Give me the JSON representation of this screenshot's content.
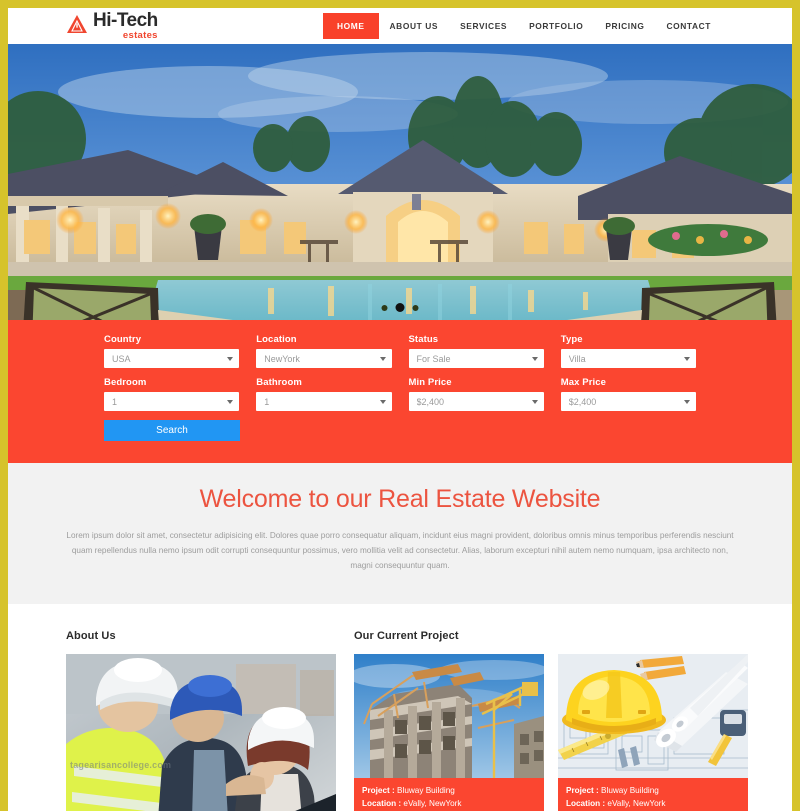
{
  "theme": {
    "border": "#d6c32b",
    "accent_red": "#fb4630",
    "accent_blue": "#2196f3",
    "heading_red": "#ec5440",
    "welcome_bg": "#f2f2f2"
  },
  "header": {
    "logo": {
      "icon": "triangle-logo-icon",
      "title": "Hi-Tech",
      "subtitle": "estates"
    },
    "nav": [
      {
        "label": "HOME",
        "active": true
      },
      {
        "label": "ABOUT US",
        "active": false
      },
      {
        "label": "SERVICES",
        "active": false
      },
      {
        "label": "PORTFOLIO",
        "active": false
      },
      {
        "label": "PRICING",
        "active": false
      },
      {
        "label": "CONTACT",
        "active": false
      }
    ]
  },
  "hero": {
    "alt": "Luxury mansion at dusk with swimming pool and lounge chairs",
    "dots": [
      {
        "active": false
      },
      {
        "active": true
      },
      {
        "active": false
      }
    ]
  },
  "search": {
    "row1": [
      {
        "label": "Country",
        "value": "USA",
        "name": "country-select"
      },
      {
        "label": "Location",
        "value": "NewYork",
        "name": "location-select"
      },
      {
        "label": "Status",
        "value": "For Sale",
        "name": "status-select"
      },
      {
        "label": "Type",
        "value": "Villa",
        "name": "type-select"
      }
    ],
    "row2": [
      {
        "label": "Bedroom",
        "value": "1",
        "name": "bedroom-select"
      },
      {
        "label": "Bathroom",
        "value": "1",
        "name": "bathroom-select"
      },
      {
        "label": "Min Price",
        "value": "$2,400",
        "name": "min-price-select"
      },
      {
        "label": "Max Price",
        "value": "$2,400",
        "name": "max-price-select"
      }
    ],
    "button_label": "Search"
  },
  "welcome": {
    "title": "Welcome to our Real Estate Website",
    "body": "Lorem ipsum dolor sit amet, consectetur adipisicing elit. Dolores quae porro consequatur aliquam, incidunt eius magni provident, doloribus omnis minus temporibus perferendis nesciunt quam repellendus nulla nemo ipsum odit corrupti consequuntur possimus, vero mollitia velit ad consectetur. Alias, laborum excepturi nihil autem nemo numquam, ipsa architecto non, magni consequuntur quam."
  },
  "about": {
    "title": "About Us",
    "image_alt": "Three construction workers in hard hats reviewing plans",
    "watermark": "tagearisancollege.com"
  },
  "projects": {
    "title": "Our Current Project",
    "cards": [
      {
        "image_alt": "High-rise building under construction with crane",
        "project_label": "Project :",
        "project_value": "Bluway Building",
        "location_label": "Location :",
        "location_value": "eVally, NewYork"
      },
      {
        "image_alt": "Yellow hard hat with rolled blueprints and measuring tape",
        "project_label": "Project :",
        "project_value": "Bluway Building",
        "location_label": "Location :",
        "location_value": "eVally, NewYork"
      }
    ]
  }
}
